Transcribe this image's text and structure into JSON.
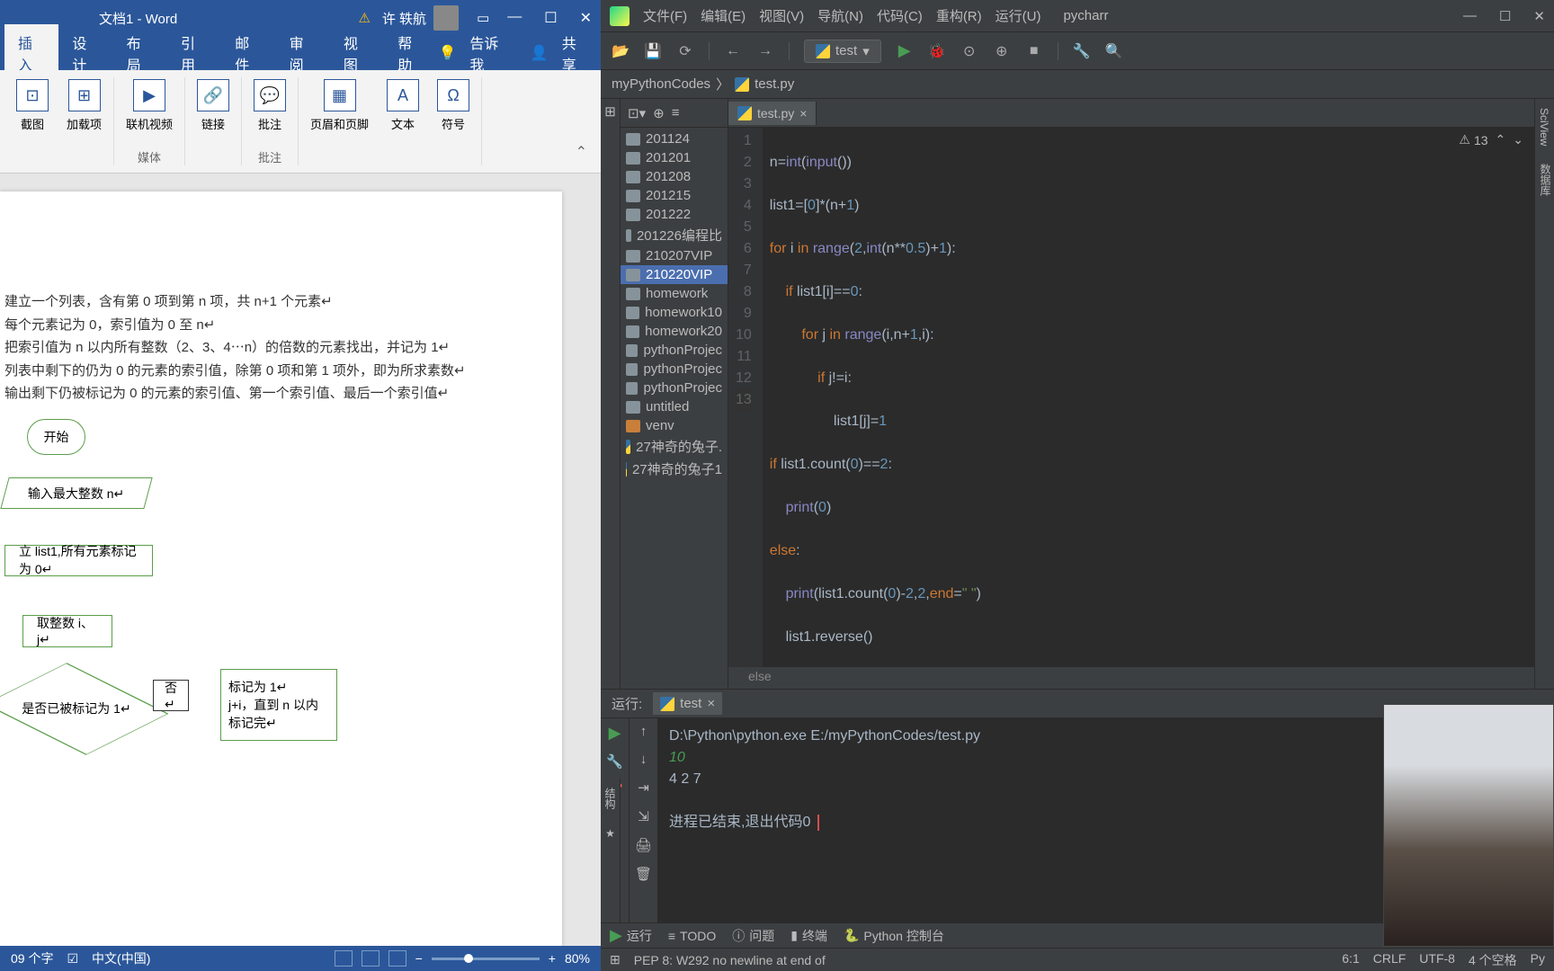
{
  "word": {
    "title": "文档1 - Word",
    "user": "许 轶航",
    "tabs": [
      "插入",
      "设计",
      "布局",
      "引用",
      "邮件",
      "审阅",
      "视图",
      "帮助"
    ],
    "tellme": "告诉我",
    "share": "共享",
    "ribbon": {
      "g1_items": [
        "截图",
        "加载项"
      ],
      "g1_label": "媒体",
      "g2_items": [
        "联机视频"
      ],
      "g3_items": [
        "链接"
      ],
      "g4_items": [
        "批注"
      ],
      "g4_label": "批注",
      "g5_items": [
        "页眉和页脚",
        "文本",
        "符号"
      ]
    },
    "doc_lines": [
      "建立一个列表，含有第 0 项到第 n 项，共 n+1 个元素↵",
      "每个元素记为 0，索引值为 0 至 n↵",
      "把索引值为 n 以内所有整数（2、3、4⋯n）的倍数的元素找出，并记为 1↵",
      "列表中剩下的仍为 0 的元素的索引值，除第 0 项和第 1 项外，即为所求素数↵",
      "输出剩下仍被标记为 0 的元素的索引值、第一个索引值、最后一个索引值↵"
    ],
    "flow": {
      "start": "开始",
      "input": "输入最大整数 n↵",
      "p1": "立 list1,所有元素标记为 0↵",
      "p2": "取整数 i、j↵",
      "diamond": "是否已被标记为 1↵",
      "no": "否↵",
      "mark_l1": "标记为 1↵",
      "mark_l2": "j+i，直到 n 以内",
      "mark_l3": "标记完↵"
    },
    "status": {
      "words": "09 个字",
      "lang": "中文(中国)",
      "zoom": "80%"
    }
  },
  "pycharm": {
    "title": "pycharr",
    "menus": [
      "文件(F)",
      "编辑(E)",
      "视图(V)",
      "导航(N)",
      "代码(C)",
      "重构(R)",
      "运行(U)"
    ],
    "run_config": "test",
    "breadcrumb": {
      "project": "myPythonCodes",
      "file": "test.py"
    },
    "tree": [
      {
        "name": "201124",
        "type": "folder"
      },
      {
        "name": "201201",
        "type": "folder"
      },
      {
        "name": "201208",
        "type": "folder"
      },
      {
        "name": "201215",
        "type": "folder"
      },
      {
        "name": "201222",
        "type": "folder"
      },
      {
        "name": "201226编程比",
        "type": "folder"
      },
      {
        "name": "210207VIP",
        "type": "folder"
      },
      {
        "name": "210220VIP",
        "type": "folder",
        "selected": true
      },
      {
        "name": "homework",
        "type": "folder"
      },
      {
        "name": "homework10",
        "type": "folder"
      },
      {
        "name": "homework20",
        "type": "folder"
      },
      {
        "name": "pythonProjec",
        "type": "folder"
      },
      {
        "name": "pythonProjec",
        "type": "folder"
      },
      {
        "name": "pythonProjec",
        "type": "folder"
      },
      {
        "name": "untitled",
        "type": "folder"
      },
      {
        "name": "venv",
        "type": "folder",
        "orange": true
      },
      {
        "name": "27神奇的兔子.",
        "type": "py"
      },
      {
        "name": "27神奇的兔子1",
        "type": "py"
      }
    ],
    "editor_tab": "test.py",
    "inspection_count": "13",
    "code_crumb": "else",
    "run": {
      "label": "运行:",
      "tab": "test",
      "cmd": "D:\\Python\\python.exe E:/myPythonCodes/test.py",
      "input": "10",
      "output": "4 2 7",
      "exit": "进程已结束,退出代码0"
    },
    "bottom_tools": [
      "运行",
      "TODO",
      "问题",
      "终端",
      "Python 控制台"
    ],
    "status": {
      "msg": "PEP 8: W292 no newline at end of",
      "pos": "6:1",
      "eol": "CRLF",
      "enc": "UTF-8",
      "indent": "4 个空格",
      "py": "Py"
    }
  }
}
